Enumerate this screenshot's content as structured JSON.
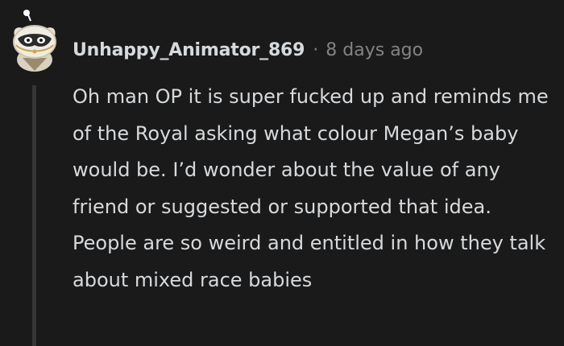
{
  "comment": {
    "author": "Unhappy_Animator_869",
    "separator": "·",
    "time_ago": "8 days ago",
    "body": "Oh man OP it is super fucked up and reminds me of the Royal asking what colour Megan’s baby would be. I’d wonder about the value of any friend or suggested or supported that idea. People are so weird and entitled in how they talk about mixed race babies"
  },
  "avatar": {
    "icon": "snoo-avatar-icon",
    "colors": {
      "bg": "#cfc6ad",
      "accent": "#ffffff",
      "mask": "#2b2b2b"
    }
  },
  "colors": {
    "background": "#1a1a1b",
    "text": "#d7dadc",
    "meta": "#818384",
    "thread_line": "#343536"
  }
}
